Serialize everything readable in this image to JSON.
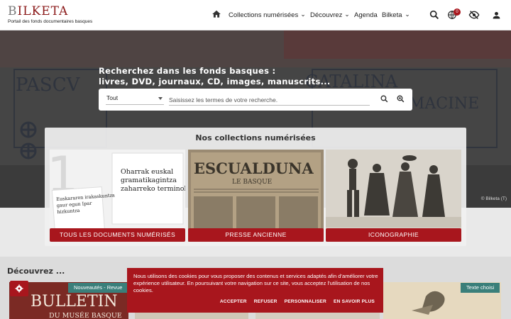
{
  "header": {
    "logo": {
      "first": "B",
      "rest": "ILKETA",
      "subtitle": "Portail des fonds documentaires basques"
    },
    "nav": {
      "collections": "Collections numérisées",
      "discover": "Découvrez",
      "agenda": "Agenda",
      "bilketa": "Bilketa"
    },
    "notification_count": "0",
    "icons": [
      "home-icon",
      "search-icon",
      "globe-icon",
      "eye-off-icon",
      "user-icon"
    ]
  },
  "hero": {
    "search_title_line1": "Recherchez dans les fonds basques :",
    "search_title_line2": "livres, DVD, journaux, CD, images, manuscrits...",
    "select_value": "Tout",
    "search_placeholder": "Saisissez les termes de votre recherche.",
    "credit": "© Bilketa (T)",
    "wall_text_left": "PASCV",
    "wall_text_right": "CATALINA",
    "wall_text_right2": "AMACINE"
  },
  "collections": {
    "title": "Nos collections numérisées",
    "cards": [
      {
        "label": "TOUS LES DOCUMENTS NUMÉRISÉS",
        "book_line1": "Oharrak euskal",
        "book_line2": "gramatikagintza",
        "book_line3": "zaharreko terminologiaz",
        "book_cover1": "Euskararen irakaskuntza",
        "book_cover2": "gaur egun Ipar",
        "book_cover3": "hizkuntza",
        "book_number": "1"
      },
      {
        "label": "PRESSE ANCIENNE",
        "newspaper_title": "ESCUALDUNA",
        "newspaper_sub": "LE BASQUE"
      },
      {
        "label": "ICONOGRAPHIE"
      }
    ]
  },
  "discover": {
    "title": "Découvrez ...",
    "items": [
      {
        "tag": "Nouveautés - Revue",
        "title_line1": "BULLETIN",
        "title_line2": "DU MUSÉE BASQUE"
      },
      {
        "tag": "Texte choisi"
      }
    ]
  },
  "cookie": {
    "text": "Nous utilisons des cookies pour vous proposer des contenus et services adaptés afin d'améliorer votre expérience utilisateur. En poursuivant votre navigation sur ce site, vous acceptez l'utilisation de nos cookies.",
    "accept": "ACCEPTER",
    "refuse": "REFUSER",
    "customize": "PERSONNALISER",
    "learn_more": "EN SAVOIR PLUS"
  },
  "colors": {
    "brand_red": "#a8161d",
    "teal_tag": "#3a7f7a"
  }
}
